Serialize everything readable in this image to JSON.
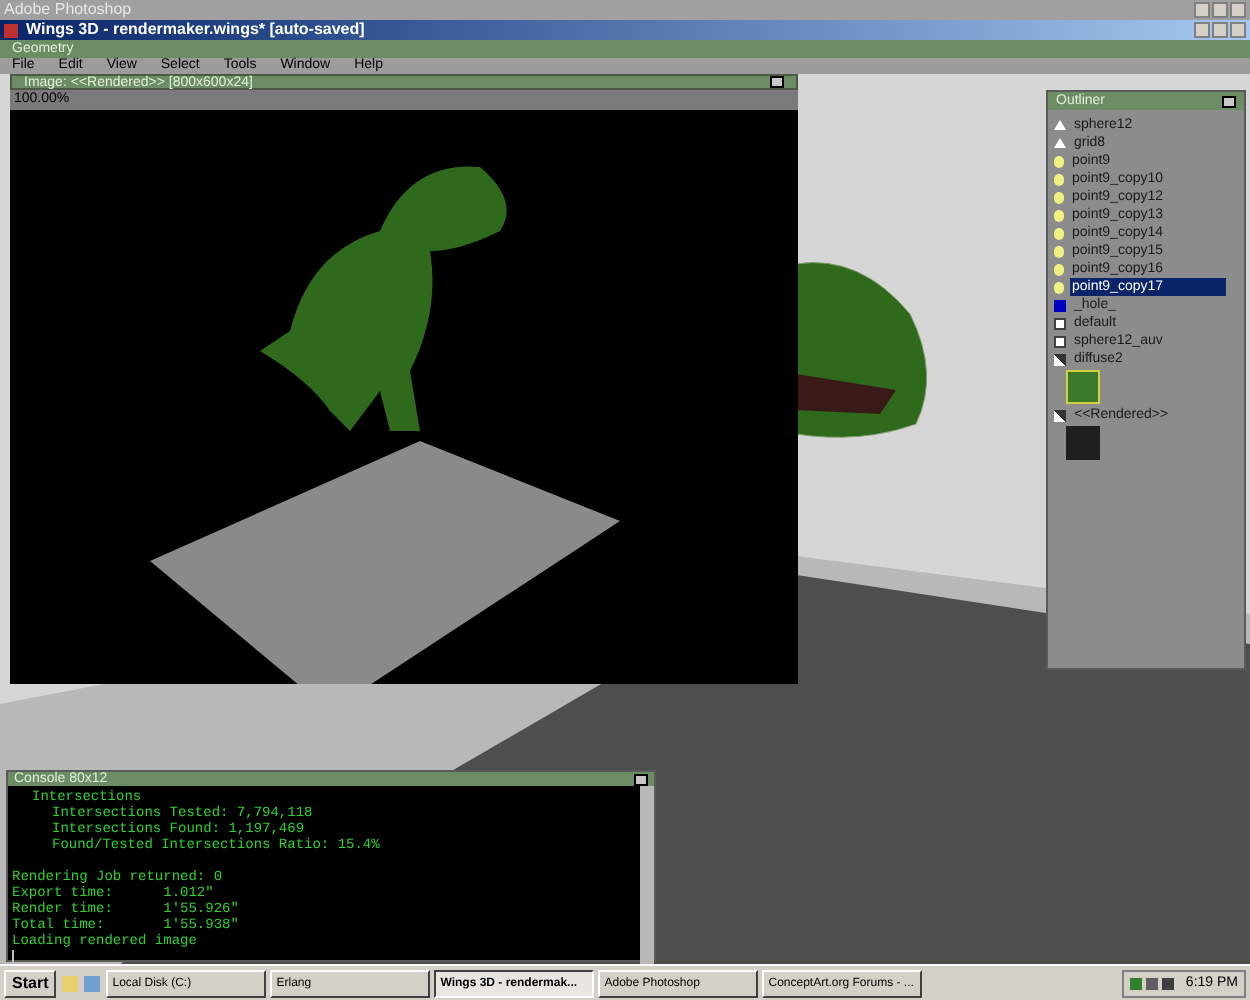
{
  "photoshop_window": {
    "title": "Adobe Photoshop"
  },
  "window": {
    "title": "Wings 3D - rendermaker.wings* [auto-saved]"
  },
  "geometry_bar": {
    "title": "Geometry"
  },
  "menu": [
    "File",
    "Edit",
    "View",
    "Select",
    "Tools",
    "Window",
    "Help"
  ],
  "image_window": {
    "title": "Image: <<Rendered>> [800x600x24]",
    "zoom": "100.00%"
  },
  "outliner": {
    "title": "Outliner",
    "items": [
      {
        "label": "sphere12",
        "kind": "object",
        "selected": false
      },
      {
        "label": "grid8",
        "kind": "object",
        "selected": false
      },
      {
        "label": "point9",
        "kind": "light",
        "selected": false
      },
      {
        "label": "point9_copy10",
        "kind": "light",
        "selected": false
      },
      {
        "label": "point9_copy12",
        "kind": "light",
        "selected": false
      },
      {
        "label": "point9_copy13",
        "kind": "light",
        "selected": false
      },
      {
        "label": "point9_copy14",
        "kind": "light",
        "selected": false
      },
      {
        "label": "point9_copy15",
        "kind": "light",
        "selected": false
      },
      {
        "label": "point9_copy16",
        "kind": "light",
        "selected": false
      },
      {
        "label": "point9_copy17",
        "kind": "light",
        "selected": true
      },
      {
        "label": "_hole_",
        "kind": "color",
        "selected": false
      },
      {
        "label": "default",
        "kind": "material",
        "selected": false
      },
      {
        "label": "sphere12_auv",
        "kind": "material",
        "selected": false
      },
      {
        "label": "diffuse2",
        "kind": "texture",
        "selected": false
      },
      {
        "label": "<<Rendered>>",
        "kind": "render",
        "selected": false
      }
    ]
  },
  "console": {
    "title": "Console 80x12",
    "sections": [
      {
        "lines": [
          {
            "text": "Intersections",
            "children": [
              {
                "text": "Intersections Tested: 7,794,118"
              },
              {
                "text": "Intersections Found: 1,197,469"
              },
              {
                "text": "Found/Tested Intersections Ratio: 15.4%"
              }
            ]
          }
        ]
      },
      {
        "lines": [
          {
            "text": "Rendering Job returned: 0"
          },
          {
            "text": "Export time:      1.012\""
          },
          {
            "text": "Render time:      1'55.926\""
          },
          {
            "text": "Total time:       1'55.938\""
          },
          {
            "text": "Loading rendered image"
          }
        ]
      }
    ]
  },
  "taskbar": {
    "start": "Start",
    "buttons": [
      {
        "label": "Local Disk (C:)",
        "selected": false
      },
      {
        "label": "Erlang",
        "selected": false
      },
      {
        "label": "Wings 3D - rendermak...",
        "selected": true
      },
      {
        "label": "Adobe Photoshop",
        "selected": false
      },
      {
        "label": "ConceptArt.org Forums - ...",
        "selected": false
      }
    ],
    "clock": "6:19 PM"
  }
}
